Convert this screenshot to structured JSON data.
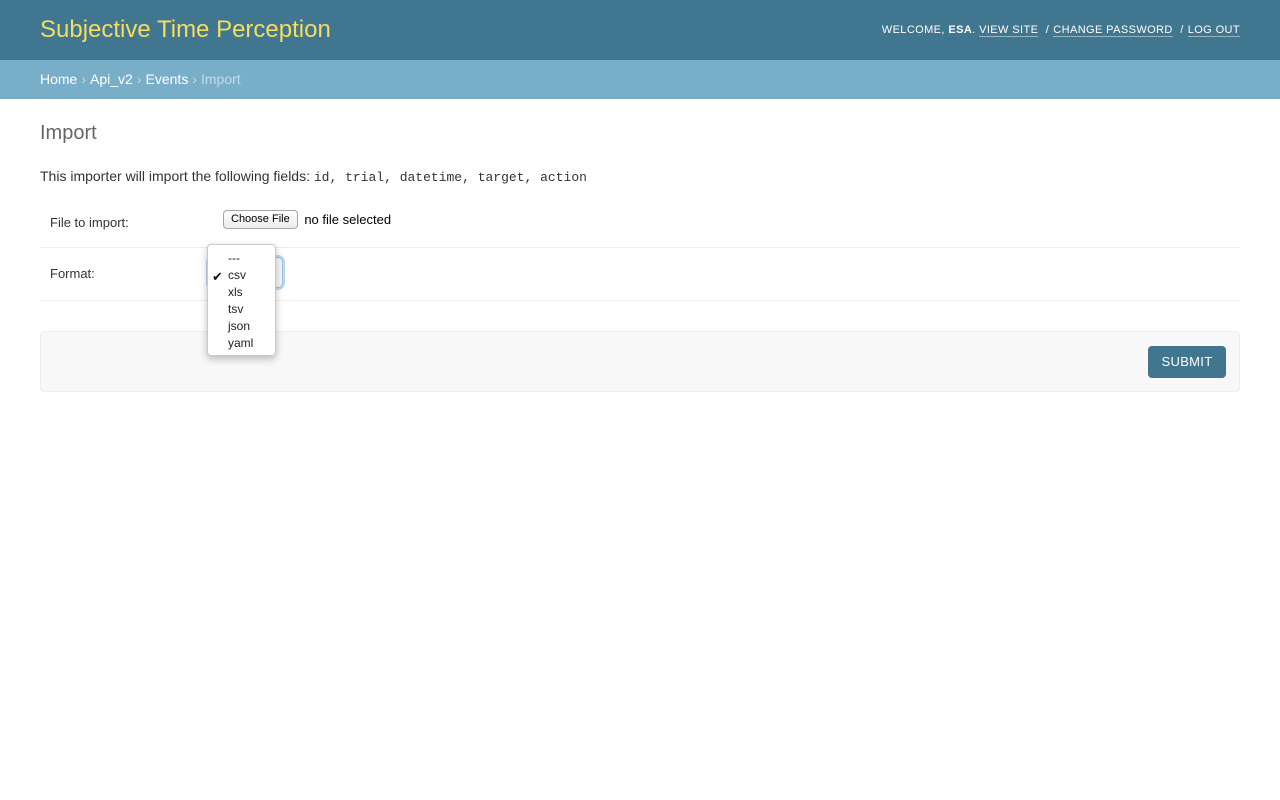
{
  "header": {
    "site_name": "Subjective Time Perception",
    "welcome_prefix": "WELCOME,",
    "user_name": "ESA",
    "welcome_suffix": ".",
    "links": {
      "view_site": "VIEW SITE",
      "change_password": "CHANGE PASSWORD",
      "log_out": "LOG OUT"
    },
    "separator": "/"
  },
  "breadcrumbs": {
    "items": [
      "Home",
      "Api_v2",
      "Events"
    ],
    "current": "Import",
    "separator": "›"
  },
  "page": {
    "title": "Import",
    "intro_text": "This importer will import the following fields:",
    "fields": "id, trial, datetime, target, action"
  },
  "form": {
    "file_label": "File to import:",
    "choose_file_label": "Choose File",
    "file_status": "no file selected",
    "format_label": "Format:",
    "format_options": [
      "---",
      "csv",
      "xls",
      "tsv",
      "json",
      "yaml"
    ],
    "format_selected": "csv",
    "submit_label": "SUBMIT"
  },
  "colors": {
    "header_bg": "#417690",
    "brand_text": "#f5dd5d",
    "breadcrumb_bg": "#79aec8",
    "submit_bg": "#417690"
  }
}
